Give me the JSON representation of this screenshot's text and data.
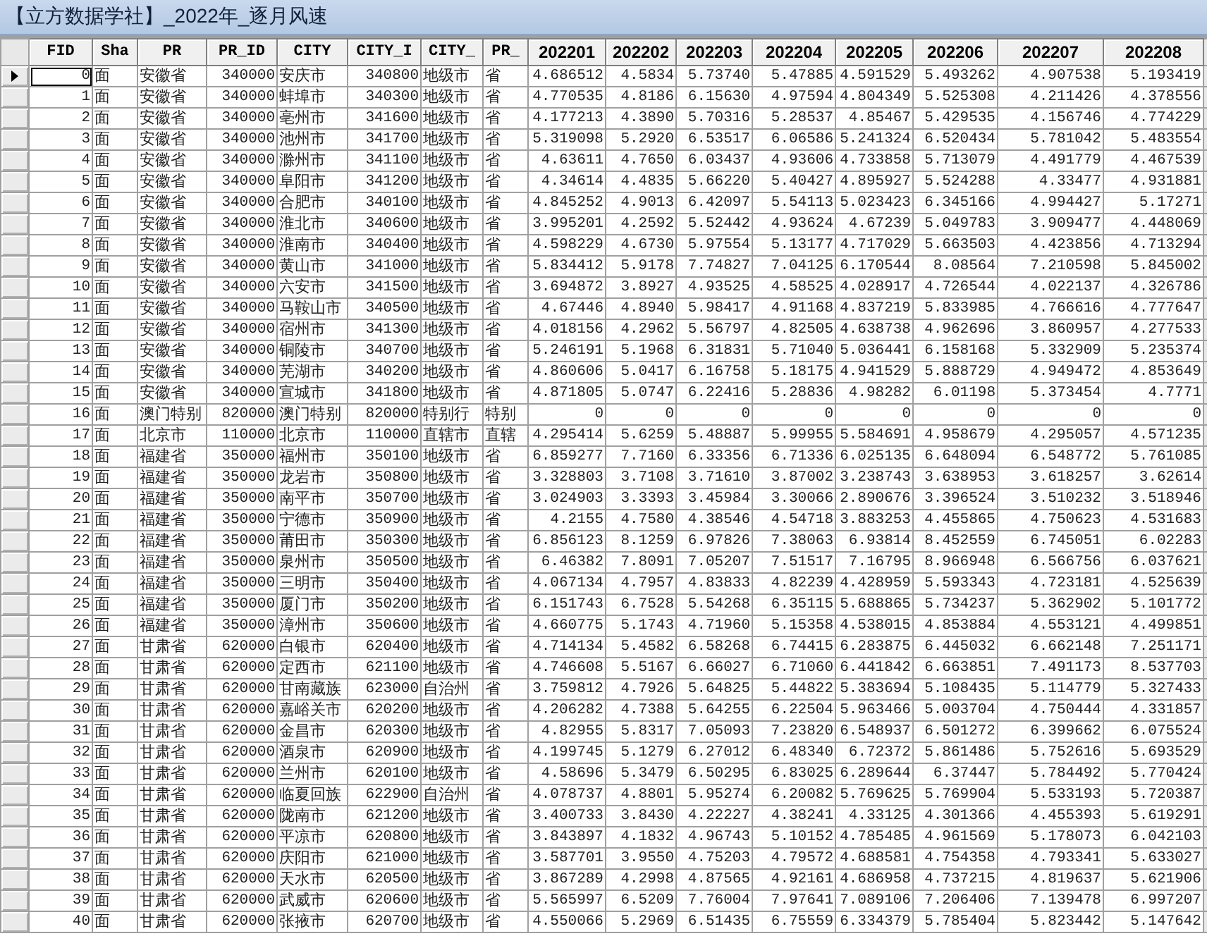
{
  "window": {
    "title": "【立方数据学社】_2022年_逐月风速"
  },
  "table": {
    "columns": [
      {
        "name": "FID",
        "kind": "number"
      },
      {
        "name": "Sha",
        "kind": "text"
      },
      {
        "name": "PR",
        "kind": "text"
      },
      {
        "name": "PR_ID",
        "kind": "number"
      },
      {
        "name": "CITY",
        "kind": "text"
      },
      {
        "name": "CITY_I",
        "kind": "number"
      },
      {
        "name": "CITY_",
        "kind": "text"
      },
      {
        "name": "PR_",
        "kind": "text"
      },
      {
        "name": "202201",
        "kind": "number"
      },
      {
        "name": "202202",
        "kind": "number"
      },
      {
        "name": "202203",
        "kind": "number"
      },
      {
        "name": "202204",
        "kind": "number"
      },
      {
        "name": "202205",
        "kind": "number"
      },
      {
        "name": "202206",
        "kind": "number"
      },
      {
        "name": "202207",
        "kind": "number"
      },
      {
        "name": "202208",
        "kind": "number"
      }
    ],
    "rows": [
      {
        "selected": true,
        "cells": [
          "0",
          "面",
          "安徽省",
          "340000",
          "安庆市",
          "340800",
          "地级市",
          "省",
          "4.686512",
          "4.5834",
          "5.73740",
          "5.47885",
          "4.591529",
          "5.493262",
          "4.907538",
          "5.193419"
        ]
      },
      {
        "selected": false,
        "cells": [
          "1",
          "面",
          "安徽省",
          "340000",
          "蚌埠市",
          "340300",
          "地级市",
          "省",
          "4.770535",
          "4.8186",
          "6.15630",
          "4.97594",
          "4.804349",
          "5.525308",
          "4.211426",
          "4.378556"
        ]
      },
      {
        "selected": false,
        "cells": [
          "2",
          "面",
          "安徽省",
          "340000",
          "亳州市",
          "341600",
          "地级市",
          "省",
          "4.177213",
          "4.3890",
          "5.70316",
          "5.28537",
          "4.85467",
          "5.429535",
          "4.156746",
          "4.774229"
        ]
      },
      {
        "selected": false,
        "cells": [
          "3",
          "面",
          "安徽省",
          "340000",
          "池州市",
          "341700",
          "地级市",
          "省",
          "5.319098",
          "5.2920",
          "6.53517",
          "6.06586",
          "5.241324",
          "6.520434",
          "5.781042",
          "5.483554"
        ]
      },
      {
        "selected": false,
        "cells": [
          "4",
          "面",
          "安徽省",
          "340000",
          "滁州市",
          "341100",
          "地级市",
          "省",
          "4.63611",
          "4.7650",
          "6.03437",
          "4.93606",
          "4.733858",
          "5.713079",
          "4.491779",
          "4.467539"
        ]
      },
      {
        "selected": false,
        "cells": [
          "5",
          "面",
          "安徽省",
          "340000",
          "阜阳市",
          "341200",
          "地级市",
          "省",
          "4.34614",
          "4.4835",
          "5.66220",
          "5.40427",
          "4.895927",
          "5.524288",
          "4.33477",
          "4.931881"
        ]
      },
      {
        "selected": false,
        "cells": [
          "6",
          "面",
          "安徽省",
          "340000",
          "合肥市",
          "340100",
          "地级市",
          "省",
          "4.845252",
          "4.9013",
          "6.42097",
          "5.54113",
          "5.023423",
          "6.345166",
          "4.994427",
          "5.17271"
        ]
      },
      {
        "selected": false,
        "cells": [
          "7",
          "面",
          "安徽省",
          "340000",
          "淮北市",
          "340600",
          "地级市",
          "省",
          "3.995201",
          "4.2592",
          "5.52442",
          "4.93624",
          "4.67239",
          "5.049783",
          "3.909477",
          "4.448069"
        ]
      },
      {
        "selected": false,
        "cells": [
          "8",
          "面",
          "安徽省",
          "340000",
          "淮南市",
          "340400",
          "地级市",
          "省",
          "4.598229",
          "4.6730",
          "5.97554",
          "5.13177",
          "4.717029",
          "5.663503",
          "4.423856",
          "4.713294"
        ]
      },
      {
        "selected": false,
        "cells": [
          "9",
          "面",
          "安徽省",
          "340000",
          "黄山市",
          "341000",
          "地级市",
          "省",
          "5.834412",
          "5.9178",
          "7.74827",
          "7.04125",
          "6.170544",
          "8.08564",
          "7.210598",
          "5.845002"
        ]
      },
      {
        "selected": false,
        "cells": [
          "10",
          "面",
          "安徽省",
          "340000",
          "六安市",
          "341500",
          "地级市",
          "省",
          "3.694872",
          "3.8927",
          "4.93525",
          "4.58525",
          "4.028917",
          "4.726544",
          "4.022137",
          "4.326786"
        ]
      },
      {
        "selected": false,
        "cells": [
          "11",
          "面",
          "安徽省",
          "340000",
          "马鞍山市",
          "340500",
          "地级市",
          "省",
          "4.67446",
          "4.8940",
          "5.98417",
          "4.91168",
          "4.837219",
          "5.833985",
          "4.766616",
          "4.777647"
        ]
      },
      {
        "selected": false,
        "cells": [
          "12",
          "面",
          "安徽省",
          "340000",
          "宿州市",
          "341300",
          "地级市",
          "省",
          "4.018156",
          "4.2962",
          "5.56797",
          "4.82505",
          "4.638738",
          "4.962696",
          "3.860957",
          "4.277533"
        ]
      },
      {
        "selected": false,
        "cells": [
          "13",
          "面",
          "安徽省",
          "340000",
          "铜陵市",
          "340700",
          "地级市",
          "省",
          "5.246191",
          "5.1968",
          "6.31831",
          "5.71040",
          "5.036441",
          "6.158168",
          "5.332909",
          "5.235374"
        ]
      },
      {
        "selected": false,
        "cells": [
          "14",
          "面",
          "安徽省",
          "340000",
          "芜湖市",
          "340200",
          "地级市",
          "省",
          "4.860606",
          "5.0417",
          "6.16758",
          "5.18175",
          "4.941529",
          "5.888729",
          "4.949472",
          "4.853649"
        ]
      },
      {
        "selected": false,
        "cells": [
          "15",
          "面",
          "安徽省",
          "340000",
          "宣城市",
          "341800",
          "地级市",
          "省",
          "4.871805",
          "5.0747",
          "6.22416",
          "5.28836",
          "4.98282",
          "6.01198",
          "5.373454",
          "4.7771"
        ]
      },
      {
        "selected": false,
        "cells": [
          "16",
          "面",
          "澳门特别",
          "820000",
          "澳门特别",
          "820000",
          "特别行",
          "特别",
          "0",
          "0",
          "0",
          "0",
          "0",
          "0",
          "0",
          "0"
        ]
      },
      {
        "selected": false,
        "cells": [
          "17",
          "面",
          "北京市",
          "110000",
          "北京市",
          "110000",
          "直辖市",
          "直辖",
          "4.295414",
          "5.6259",
          "5.48887",
          "5.99955",
          "5.584691",
          "4.958679",
          "4.295057",
          "4.571235"
        ]
      },
      {
        "selected": false,
        "cells": [
          "18",
          "面",
          "福建省",
          "350000",
          "福州市",
          "350100",
          "地级市",
          "省",
          "6.859277",
          "7.7160",
          "6.33356",
          "6.71336",
          "6.025135",
          "6.648094",
          "6.548772",
          "5.761085"
        ]
      },
      {
        "selected": false,
        "cells": [
          "19",
          "面",
          "福建省",
          "350000",
          "龙岩市",
          "350800",
          "地级市",
          "省",
          "3.328803",
          "3.7108",
          "3.71610",
          "3.87002",
          "3.238743",
          "3.638953",
          "3.618257",
          "3.62614"
        ]
      },
      {
        "selected": false,
        "cells": [
          "20",
          "面",
          "福建省",
          "350000",
          "南平市",
          "350700",
          "地级市",
          "省",
          "3.024903",
          "3.3393",
          "3.45984",
          "3.30066",
          "2.890676",
          "3.396524",
          "3.510232",
          "3.518946"
        ]
      },
      {
        "selected": false,
        "cells": [
          "21",
          "面",
          "福建省",
          "350000",
          "宁德市",
          "350900",
          "地级市",
          "省",
          "4.2155",
          "4.7580",
          "4.38546",
          "4.54718",
          "3.883253",
          "4.455865",
          "4.750623",
          "4.531683"
        ]
      },
      {
        "selected": false,
        "cells": [
          "22",
          "面",
          "福建省",
          "350000",
          "莆田市",
          "350300",
          "地级市",
          "省",
          "6.856123",
          "8.1259",
          "6.97826",
          "7.38063",
          "6.93814",
          "8.452559",
          "6.745051",
          "6.02283"
        ]
      },
      {
        "selected": false,
        "cells": [
          "23",
          "面",
          "福建省",
          "350000",
          "泉州市",
          "350500",
          "地级市",
          "省",
          "6.46382",
          "7.8091",
          "7.05207",
          "7.51517",
          "7.16795",
          "8.966948",
          "6.566756",
          "6.037621"
        ]
      },
      {
        "selected": false,
        "cells": [
          "24",
          "面",
          "福建省",
          "350000",
          "三明市",
          "350400",
          "地级市",
          "省",
          "4.067134",
          "4.7957",
          "4.83833",
          "4.82239",
          "4.428959",
          "5.593343",
          "4.723181",
          "4.525639"
        ]
      },
      {
        "selected": false,
        "cells": [
          "25",
          "面",
          "福建省",
          "350000",
          "厦门市",
          "350200",
          "地级市",
          "省",
          "6.151743",
          "6.7528",
          "5.54268",
          "6.35115",
          "5.688865",
          "5.734237",
          "5.362902",
          "5.101772"
        ]
      },
      {
        "selected": false,
        "cells": [
          "26",
          "面",
          "福建省",
          "350000",
          "漳州市",
          "350600",
          "地级市",
          "省",
          "4.660775",
          "5.1743",
          "4.71960",
          "5.15358",
          "4.538015",
          "4.853884",
          "4.553121",
          "4.499851"
        ]
      },
      {
        "selected": false,
        "cells": [
          "27",
          "面",
          "甘肃省",
          "620000",
          "白银市",
          "620400",
          "地级市",
          "省",
          "4.714134",
          "5.4582",
          "6.58268",
          "6.74415",
          "6.283875",
          "6.445032",
          "6.662148",
          "7.251171"
        ]
      },
      {
        "selected": false,
        "cells": [
          "28",
          "面",
          "甘肃省",
          "620000",
          "定西市",
          "621100",
          "地级市",
          "省",
          "4.746608",
          "5.5167",
          "6.66027",
          "6.71060",
          "6.441842",
          "6.663851",
          "7.491173",
          "8.537703"
        ]
      },
      {
        "selected": false,
        "cells": [
          "29",
          "面",
          "甘肃省",
          "620000",
          "甘南藏族",
          "623000",
          "自治州",
          "省",
          "3.759812",
          "4.7926",
          "5.64825",
          "5.44822",
          "5.383694",
          "5.108435",
          "5.114779",
          "5.327433"
        ]
      },
      {
        "selected": false,
        "cells": [
          "30",
          "面",
          "甘肃省",
          "620000",
          "嘉峪关市",
          "620200",
          "地级市",
          "省",
          "4.206282",
          "4.7388",
          "5.64255",
          "6.22504",
          "5.963466",
          "5.003704",
          "4.750444",
          "4.331857"
        ]
      },
      {
        "selected": false,
        "cells": [
          "31",
          "面",
          "甘肃省",
          "620000",
          "金昌市",
          "620300",
          "地级市",
          "省",
          "4.82955",
          "5.8317",
          "7.05093",
          "7.23820",
          "6.548937",
          "6.501272",
          "6.399662",
          "6.075524"
        ]
      },
      {
        "selected": false,
        "cells": [
          "32",
          "面",
          "甘肃省",
          "620000",
          "酒泉市",
          "620900",
          "地级市",
          "省",
          "4.199745",
          "5.1279",
          "6.27012",
          "6.48340",
          "6.72372",
          "5.861486",
          "5.752616",
          "5.693529"
        ]
      },
      {
        "selected": false,
        "cells": [
          "33",
          "面",
          "甘肃省",
          "620000",
          "兰州市",
          "620100",
          "地级市",
          "省",
          "4.58696",
          "5.3479",
          "6.50295",
          "6.83025",
          "6.289644",
          "6.37447",
          "5.784492",
          "5.770424"
        ]
      },
      {
        "selected": false,
        "cells": [
          "34",
          "面",
          "甘肃省",
          "620000",
          "临夏回族",
          "622900",
          "自治州",
          "省",
          "4.078737",
          "4.8801",
          "5.95274",
          "6.20082",
          "5.769625",
          "5.769904",
          "5.533193",
          "5.720387"
        ]
      },
      {
        "selected": false,
        "cells": [
          "35",
          "面",
          "甘肃省",
          "620000",
          "陇南市",
          "621200",
          "地级市",
          "省",
          "3.400733",
          "3.8430",
          "4.22227",
          "4.38241",
          "4.33125",
          "4.301366",
          "4.455393",
          "5.619291"
        ]
      },
      {
        "selected": false,
        "cells": [
          "36",
          "面",
          "甘肃省",
          "620000",
          "平凉市",
          "620800",
          "地级市",
          "省",
          "3.843897",
          "4.1832",
          "4.96743",
          "5.10152",
          "4.785485",
          "4.961569",
          "5.178073",
          "6.042103"
        ]
      },
      {
        "selected": false,
        "cells": [
          "37",
          "面",
          "甘肃省",
          "620000",
          "庆阳市",
          "621000",
          "地级市",
          "省",
          "3.587701",
          "3.9550",
          "4.75203",
          "4.79572",
          "4.688581",
          "4.754358",
          "4.793341",
          "5.633027"
        ]
      },
      {
        "selected": false,
        "cells": [
          "38",
          "面",
          "甘肃省",
          "620000",
          "天水市",
          "620500",
          "地级市",
          "省",
          "3.867289",
          "4.2998",
          "4.87565",
          "4.92161",
          "4.686958",
          "4.737215",
          "4.819637",
          "5.621906"
        ]
      },
      {
        "selected": false,
        "cells": [
          "39",
          "面",
          "甘肃省",
          "620000",
          "武威市",
          "620600",
          "地级市",
          "省",
          "5.565997",
          "6.5209",
          "7.76004",
          "7.97641",
          "7.089106",
          "7.206406",
          "7.139478",
          "6.997207"
        ]
      },
      {
        "selected": false,
        "cells": [
          "40",
          "面",
          "甘肃省",
          "620000",
          "张掖市",
          "620700",
          "地级市",
          "省",
          "4.550066",
          "5.2969",
          "6.51435",
          "6.75559",
          "6.334379",
          "5.785404",
          "5.823442",
          "5.147642"
        ]
      }
    ]
  }
}
